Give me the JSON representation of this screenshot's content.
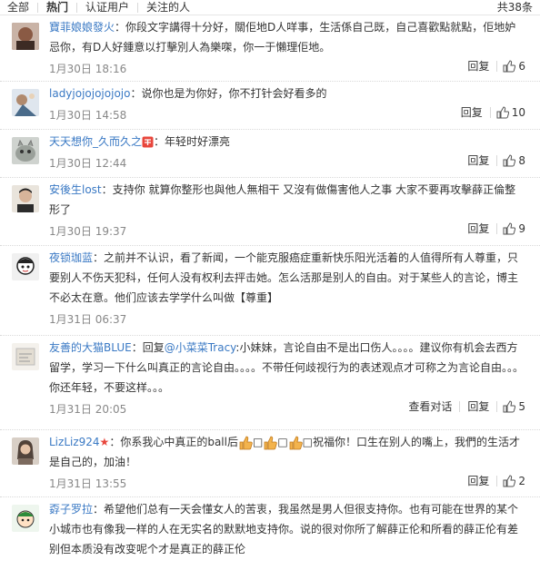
{
  "tabs": [
    "全部",
    "热门",
    "认证用户",
    "关注的人"
  ],
  "total": "共38条",
  "actions": {
    "reply": "回复",
    "view_convo": "查看对话"
  },
  "comments": [
    {
      "user": "寶菲娘娘發火",
      "colon": "：",
      "text": "你段文字講得十分好，關佢地D人咩事，生活係自己既，自己喜歡點就點，佢地妒忌你，有D人好鍾意以打擊別人為樂㗎，你一于懶理佢地。",
      "time": "1月30日 18:16",
      "likes": "6"
    },
    {
      "user": "ladyjojojojojojo",
      "colon": "：",
      "text": "说你也是为你好，你不打针会好看多的",
      "time": "1月30日 14:58",
      "likes": "10"
    },
    {
      "user": "天天想你_久而久之",
      "colon": "：",
      "text": "年轻时好漂亮",
      "time": "1月30日 12:44",
      "likes": "8"
    },
    {
      "user": "安後生lost",
      "colon": "：",
      "text": "支持你 就算你整形也與他人無相干 又沒有做傷害他人之事 大家不要再攻擊薛正倫整形了",
      "time": "1月30日 19:37",
      "likes": "9"
    },
    {
      "user": "夜锁珈蓝",
      "colon": "：",
      "text": "之前并不认识，看了新闻，一个能克服癌症重新快乐阳光活着的人值得所有人尊重，只要别人不伤天犯科，任何人没有权利去抨击她。怎么活那是别人的自由。对于某些人的言论，博主不必太在意。他们应该去学学什么叫做【尊重】",
      "time": "1月31日 06:37",
      "likes": ""
    },
    {
      "user": "友善的大猫BLUE",
      "colon": "：",
      "pre": "回复",
      "mention": "@小菜菜Tracy",
      "text": ":小妹妹，言论自由不是出口伤人。。。。建议你有机会去西方留学，学习一下什么叫真正的言论自由。。。。不带任何歧视行为的表述观点才可称之为言论自由。。。你还年轻，不要这样。。。",
      "time": "1月31日 20:05",
      "likes": "5"
    },
    {
      "user": "LizLiz924",
      "colon": "：",
      "t1": "你系我心中真正的ball后",
      "t2": "□",
      "t3": "□",
      "t4": "□祝福你！口生在别人的嘴上，我們的生活才是自己的，加油！",
      "time": "1月31日 13:55",
      "likes": "2"
    },
    {
      "user": "孬子罗拉",
      "colon": "：",
      "text": "希望他们总有一天会懂女人的苦衷，我虽然是男人但很支持你。也有可能在世界的某个小城市也有像我一样的人在无实名的默默地支持你。说的很对你所了解薛正伦和所看的薛正伦有差别但本质没有改变呢个才是真正的薛正伦",
      "time": "",
      "likes": ""
    }
  ]
}
